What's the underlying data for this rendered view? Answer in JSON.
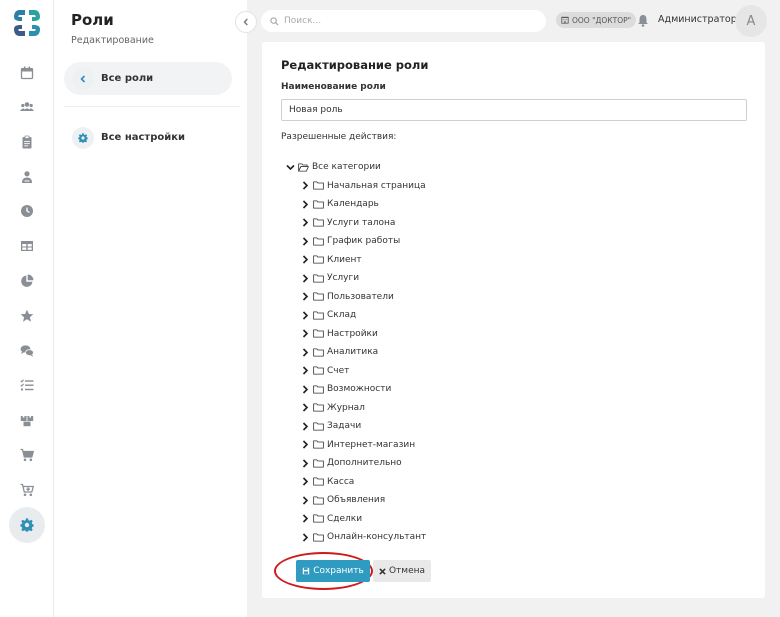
{
  "rail": {
    "items": [
      "calendar-icon",
      "users-icon",
      "clipboard-icon",
      "person-icon",
      "clock-icon",
      "table-icon",
      "pie-chart-icon",
      "star-icon",
      "chat-icon",
      "list-icon",
      "boxes-icon",
      "cart-icon",
      "cart-plus-icon",
      "gear-icon"
    ],
    "active": "gear-icon"
  },
  "sidebar": {
    "title": "Роли",
    "subtitle": "Редактирование",
    "back_label": "Все роли",
    "settings_label": "Все настройки"
  },
  "header": {
    "search_placeholder": "Поиск...",
    "org_badge": "ООО \"ДОКТОР\"",
    "user_name": "Администратор",
    "avatar_letter": "А"
  },
  "form": {
    "title": "Редактирование роли",
    "name_label": "Наименование роли",
    "name_value": "Новая роль",
    "permissions_label": "Разрешенные действия:",
    "tree_root": "Все категории",
    "categories": [
      "Начальная страница",
      "Календарь",
      "Услуги талона",
      "График работы",
      "Клиент",
      "Услуги",
      "Пользователи",
      "Склад",
      "Настройки",
      "Аналитика",
      "Счет",
      "Возможности",
      "Журнал",
      "Задачи",
      "Интернет-магазин",
      "Дополнительно",
      "Касса",
      "Объявления",
      "Сделки",
      "Онлайн-консультант"
    ],
    "save_label": "Сохранить",
    "cancel_label": "Отмена"
  },
  "colors": {
    "accent": "#2f9bc0",
    "highlight": "#d01a1a",
    "background": "#f1f1f1"
  }
}
